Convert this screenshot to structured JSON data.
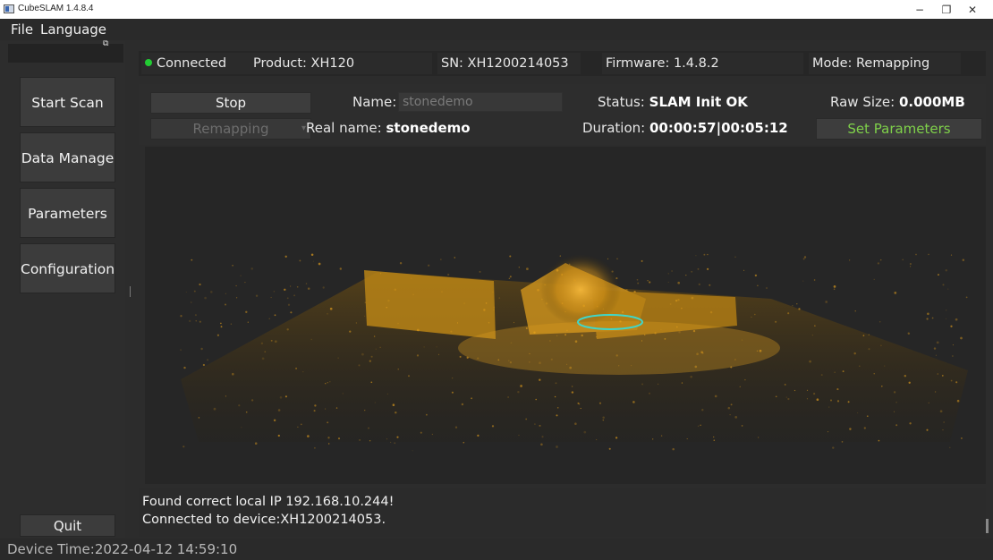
{
  "window": {
    "title": "CubeSLAM 1.4.8.4",
    "minimize": "−",
    "maximize": "❐",
    "close": "✕"
  },
  "menu": {
    "items": [
      "File",
      "Language"
    ]
  },
  "sidebar": {
    "float_icon": "⧉",
    "buttons": [
      "Start Scan",
      "Data Manage",
      "Parameters",
      "Configuration"
    ],
    "quit": "Quit"
  },
  "info": {
    "connected": "Connected",
    "connected_color": "#22cc33",
    "product": "Product: XH120",
    "sn": "SN: XH1200214053",
    "firmware": "Firmware: 1.4.8.2",
    "mode": "Mode: Remapping"
  },
  "controls": {
    "stop": "Stop",
    "remapping": "Remapping",
    "name_label": "Name:",
    "name_value": "stonedemo",
    "realname_label": "Real name:",
    "realname_value": "stonedemo",
    "status_label": "Status:",
    "status_value": "SLAM Init OK",
    "duration_label": "Duration:",
    "duration_value": "00:00:57|00:05:12",
    "rawsize_label": "Raw Size:",
    "rawsize_value": "0.000MB",
    "set_params": "Set Parameters"
  },
  "colors": {
    "point_cloud": "#e8a21c",
    "trajectory": "#40d6c8",
    "accent_green": "#7fd14a"
  },
  "log": {
    "lines": [
      "Found correct local IP 192.168.10.244!",
      "Connected to device:XH1200214053."
    ]
  },
  "status": {
    "device_time": "Device Time:2022-04-12 14:59:10"
  }
}
